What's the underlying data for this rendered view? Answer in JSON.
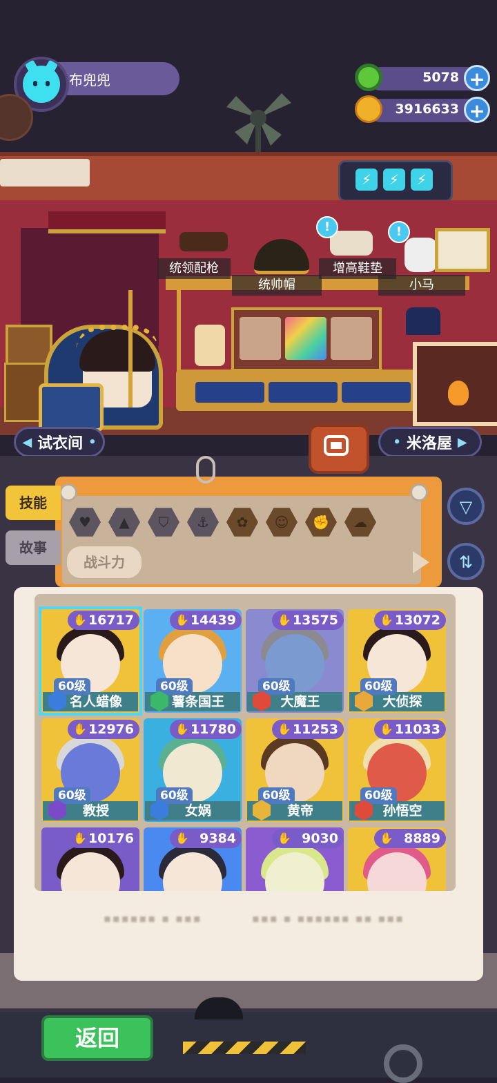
{
  "player": {
    "name": "布兜兜"
  },
  "currencies": [
    {
      "icon": "green-donut-icon",
      "value": "5078"
    },
    {
      "icon": "gold-planet-icon",
      "value": "3916633"
    }
  ],
  "room": {
    "items": [
      {
        "label": "统领配枪",
        "bubble": ""
      },
      {
        "label": "统帅帽",
        "bubble": ""
      },
      {
        "label": "增高鞋垫",
        "bubble": "!"
      },
      {
        "label": "小马",
        "bubble": "!"
      }
    ],
    "nav_left": "试衣间",
    "nav_right": "米洛屋"
  },
  "filter": {
    "tabs": [
      "技能",
      "故事"
    ],
    "sort_label": "战斗力",
    "trait_icons": [
      "heart-icon",
      "rocket-icon",
      "shield-icon",
      "anchor-icon",
      "mask-icon",
      "smile-icon",
      "muscle-icon",
      "brain-icon"
    ]
  },
  "characters": [
    {
      "name": "名人蜡像",
      "power": "16717",
      "level": "60级",
      "badge": "#3a7ddc",
      "selected": true
    },
    {
      "name": "薯条国王",
      "power": "14439",
      "level": "60级",
      "badge": "#3cb86a",
      "selected": false
    },
    {
      "name": "大魔王",
      "power": "13575",
      "level": "60级",
      "badge": "#e04a3a",
      "selected": false
    },
    {
      "name": "大侦探",
      "power": "13072",
      "level": "60级",
      "badge": "#e8a83a",
      "selected": false
    },
    {
      "name": "教授",
      "power": "12976",
      "level": "60级",
      "badge": "#7a4ac8",
      "selected": false
    },
    {
      "name": "女娲",
      "power": "11780",
      "level": "60级",
      "badge": "#3a7ddc",
      "selected": false
    },
    {
      "name": "黄帝",
      "power": "11253",
      "level": "60级",
      "badge": "#e8b43a",
      "selected": false
    },
    {
      "name": "孙悟空",
      "power": "11033",
      "level": "60级",
      "badge": "#e04a3a",
      "selected": false
    },
    {
      "name": "",
      "power": "10176",
      "level": "",
      "badge": "",
      "selected": false
    },
    {
      "name": "",
      "power": "9384",
      "level": "",
      "badge": "",
      "selected": false
    },
    {
      "name": "",
      "power": "9030",
      "level": "",
      "badge": "",
      "selected": false
    },
    {
      "name": "",
      "power": "8889",
      "level": "",
      "badge": "",
      "selected": false
    }
  ],
  "footer": {
    "back_label": "返回"
  }
}
